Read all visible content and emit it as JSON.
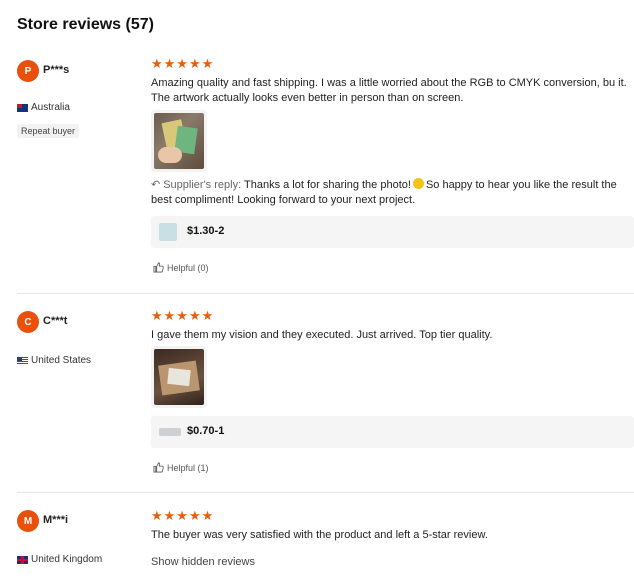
{
  "title": "Store reviews (57)",
  "reviews": [
    {
      "avatar_letter": "P",
      "username": "P***s",
      "country": "Australia",
      "badge": "Repeat buyer",
      "stars": "★★★★★",
      "text": "Amazing quality and fast shipping. I was a little worried about the RGB to CMYK conversion, bu it. The artwork actually looks even better in person than on screen.",
      "reply_label": "Supplier's reply:",
      "reply_text_1": "Thanks a lot for sharing the photo!",
      "reply_text_2": "So happy to hear you like the result the best compliment! Looking forward to your next project.",
      "price": "$1.30-2",
      "helpful": "Helpful (0)"
    },
    {
      "avatar_letter": "C",
      "username": "C***t",
      "country": "United States",
      "stars": "★★★★★",
      "text": "I gave them my vision and they executed. Just arrived. Top tier quality.",
      "price": "$0.70-1",
      "helpful": "Helpful (1)"
    },
    {
      "avatar_letter": "M",
      "username": "M***i",
      "country": "United Kingdom",
      "stars": "★★★★★",
      "text": "The buyer was very satisfied with the product and left a 5-star review.",
      "show_hidden": "Show hidden reviews"
    }
  ],
  "colors": {
    "accent": "#ea5d0a",
    "avatar_bg": "#e8500c"
  }
}
